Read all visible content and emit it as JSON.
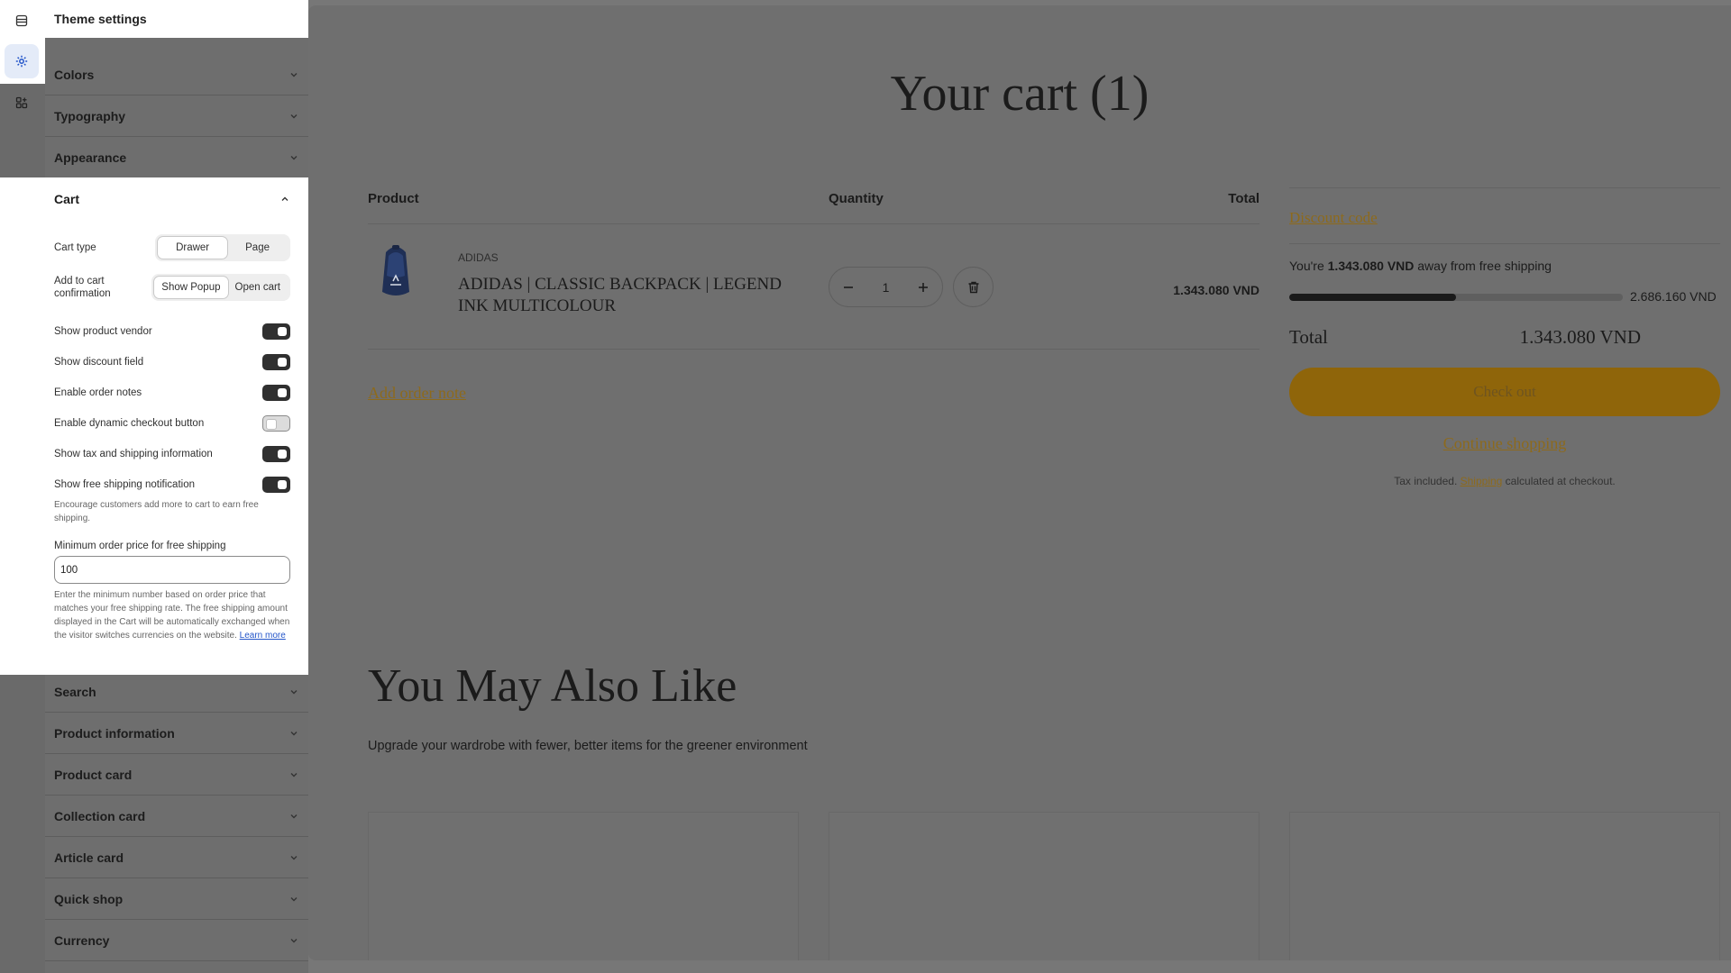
{
  "editor": {
    "panel_title": "Theme settings",
    "rail": [
      {
        "name": "sections-icon"
      },
      {
        "name": "theme-settings-icon",
        "active": true
      },
      {
        "name": "app-embeds-icon"
      }
    ],
    "accordions_above": [
      {
        "label": "Colors"
      },
      {
        "label": "Typography"
      },
      {
        "label": "Appearance"
      }
    ],
    "cart": {
      "label": "Cart",
      "cart_type": {
        "label": "Cart type",
        "options": [
          "Drawer",
          "Page"
        ],
        "selected": "Drawer"
      },
      "add_confirm": {
        "label": "Add to cart confirmation",
        "options": [
          "Show Popup",
          "Open cart"
        ],
        "selected": "Show Popup"
      },
      "toggles": [
        {
          "label": "Show product vendor",
          "on": true
        },
        {
          "label": "Show discount field",
          "on": true
        },
        {
          "label": "Enable order notes",
          "on": true
        },
        {
          "label": "Enable dynamic checkout button",
          "on": false
        },
        {
          "label": "Show tax and shipping information",
          "on": true
        },
        {
          "label": "Show free shipping notification",
          "on": true
        }
      ],
      "free_ship_help": "Encourage customers add more to cart to earn free shipping.",
      "min_price_label": "Minimum order price for free shipping",
      "min_price_value": "100",
      "min_price_help": "Enter the minimum number based on order price that matches your free shipping rate. The free shipping amount displayed in the Cart will be automatically exchanged when the visitor switches currencies on the website.",
      "learn_more": "Learn more"
    },
    "accordions_below": [
      {
        "label": "Search"
      },
      {
        "label": "Product information"
      },
      {
        "label": "Product card"
      },
      {
        "label": "Collection card"
      },
      {
        "label": "Article card"
      },
      {
        "label": "Quick shop"
      },
      {
        "label": "Currency"
      }
    ]
  },
  "store": {
    "title": "Your cart (1)",
    "headers": {
      "product": "Product",
      "quantity": "Quantity",
      "total": "Total"
    },
    "item": {
      "vendor": "ADIDAS",
      "name": "ADIDAS | CLASSIC BACKPACK | LEGEND INK MULTICOLOUR",
      "quantity": "1",
      "line_total": "1.343.080 VND"
    },
    "add_order_note": "Add order note",
    "summary": {
      "discount_code": "Discount code",
      "ship_prefix": "You're ",
      "ship_amount": "1.343.080 VND",
      "ship_suffix": " away from free shipping",
      "progress": 0.5,
      "progress_max": "2.686.160 VND",
      "total_label": "Total",
      "total_value": "1.343.080 VND",
      "checkout": "Check out",
      "continue": "Continue shopping",
      "tax_prefix": "Tax included. ",
      "tax_link": "Shipping",
      "tax_suffix": " calculated at checkout."
    },
    "recommend": {
      "title": "You May Also Like",
      "subtitle": "Upgrade your wardrobe with fewer, better items for the greener environment"
    }
  }
}
